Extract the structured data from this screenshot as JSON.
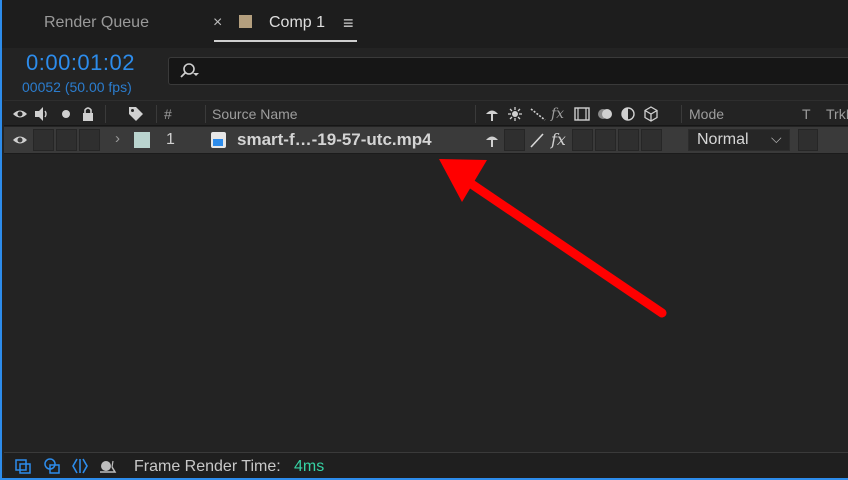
{
  "tabs": {
    "render_queue": "Render Queue",
    "close_symbol": "×",
    "comp": "Comp 1",
    "menu_symbol": "≡"
  },
  "time": {
    "timecode": "0:00:01:02",
    "frame_fps": "00052 (50.00 fps)"
  },
  "header": {
    "hash": "#",
    "source_name": "Source Name",
    "mode": "Mode",
    "t": "T",
    "trkmat": "TrkMat"
  },
  "layer": {
    "index": "1",
    "expand": "›",
    "name": "smart-f…-19-57-utc.mp4",
    "label_color": "#bad4cf",
    "mode": "Normal",
    "mode_chevron": "⌵",
    "fx": "fx"
  },
  "footer": {
    "label": "Frame Render Time:",
    "value": "4ms"
  },
  "colors": {
    "accent_blue": "#2d8ceb",
    "render_time_green": "#36d2a4",
    "annotation_arrow": "#ff0000"
  }
}
